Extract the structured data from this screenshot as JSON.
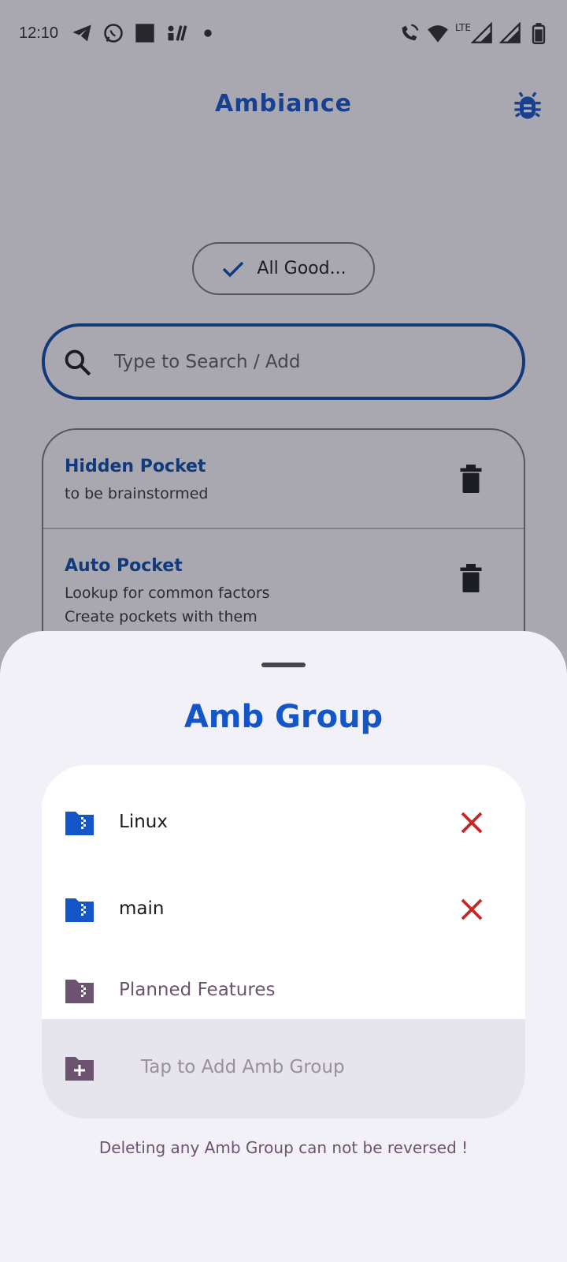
{
  "status_bar": {
    "time": "12:10",
    "left_icons": [
      "telegram-icon",
      "whatsapp-icon",
      "square-icon",
      "app-icon",
      "dot-icon"
    ],
    "right_icons": [
      "wifi-call-icon",
      "wifi-icon",
      "lte-signal-icon",
      "signal-icon",
      "battery-icon"
    ],
    "network_label": "LTE"
  },
  "header": {
    "title": "Ambiance",
    "bug_icon": "bug-icon"
  },
  "status_chip": {
    "label": "All Good...",
    "icon": "check-icon"
  },
  "search": {
    "placeholder": "Type to Search / Add",
    "icon": "search-icon"
  },
  "pockets": [
    {
      "title": "Hidden Pocket",
      "lines": [
        "to be brainstormed"
      ]
    },
    {
      "title": "Auto Pocket",
      "lines": [
        "Lookup for common factors",
        "Create pockets with them"
      ]
    }
  ],
  "sheet": {
    "title": "Amb Group",
    "groups": [
      {
        "name": "Linux",
        "deletable": true
      },
      {
        "name": "main",
        "deletable": true
      },
      {
        "name": "Planned Features",
        "deletable": false
      }
    ],
    "add_label": "Tap to Add Amb Group",
    "warning": "Deleting any Amb Group can not be reversed !"
  },
  "colors": {
    "accent": "#1455c8",
    "danger": "#c62828",
    "muted_purple": "#6c5470"
  }
}
